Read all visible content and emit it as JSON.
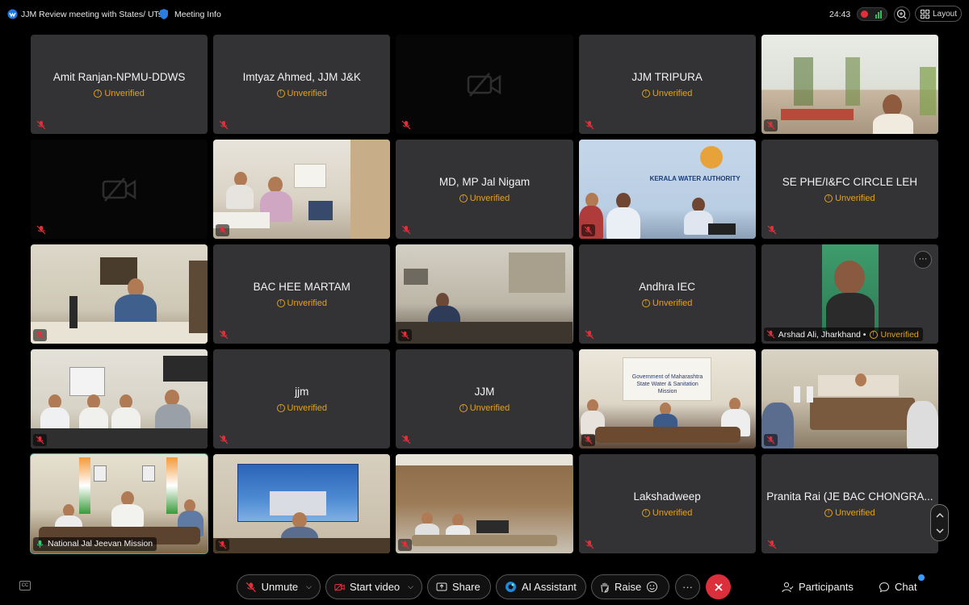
{
  "window": {
    "meeting_title": "JJM Review meeting with States/ UTs",
    "meeting_info_label": "Meeting Info",
    "timer": "24:43",
    "layout_label": "Layout"
  },
  "tiles": [
    {
      "name": "Amit Ranjan-NPMU-DDWS",
      "status": "Unverified",
      "kind": "name"
    },
    {
      "name": "Imtyaz Ahmed, JJM J&K",
      "status": "Unverified",
      "kind": "name"
    },
    {
      "name": "",
      "status": "",
      "kind": "camera-off"
    },
    {
      "name": "JJM TRIPURA",
      "status": "Unverified",
      "kind": "name"
    },
    {
      "name": "",
      "status": "",
      "kind": "video"
    },
    {
      "name": "",
      "status": "",
      "kind": "camera-off"
    },
    {
      "name": "",
      "status": "",
      "kind": "video"
    },
    {
      "name": "MD, MP Jal Nigam",
      "status": "Unverified",
      "kind": "name"
    },
    {
      "name": "",
      "status": "",
      "kind": "video",
      "sign_text": "KERALA WATER AUTHORITY"
    },
    {
      "name": "SE PHE/I&FC CIRCLE LEH",
      "status": "Unverified",
      "kind": "name"
    },
    {
      "name": "",
      "status": "",
      "kind": "video"
    },
    {
      "name": "BAC HEE MARTAM",
      "status": "Unverified",
      "kind": "name"
    },
    {
      "name": "",
      "status": "",
      "kind": "video"
    },
    {
      "name": "Andhra IEC",
      "status": "Unverified",
      "kind": "name"
    },
    {
      "name": "Arshad Ali, Jharkhand •",
      "status": "Unverified",
      "kind": "video-labeled"
    },
    {
      "name": "",
      "status": "",
      "kind": "video"
    },
    {
      "name": "jjm",
      "status": "Unverified",
      "kind": "name"
    },
    {
      "name": "JJM",
      "status": "Unverified",
      "kind": "name"
    },
    {
      "name": "",
      "status": "",
      "kind": "video",
      "sign_text": "Government of Maharashtra\nState Water & Sanitation Mission"
    },
    {
      "name": "",
      "status": "",
      "kind": "video"
    },
    {
      "name": "National Jal Jeevan Mission",
      "status": "",
      "kind": "video-active"
    },
    {
      "name": "",
      "status": "",
      "kind": "video"
    },
    {
      "name": "",
      "status": "",
      "kind": "video"
    },
    {
      "name": "Lakshadweep",
      "status": "Unverified",
      "kind": "name"
    },
    {
      "name": "Pranita Rai (JE BAC CHONGRA...",
      "status": "Unverified",
      "kind": "name"
    }
  ],
  "toolbar": {
    "unmute_label": "Unmute",
    "start_video_label": "Start video",
    "share_label": "Share",
    "ai_assistant_label": "AI Assistant",
    "raise_label": "Raise",
    "more_label": "···",
    "participants_label": "Participants",
    "chat_label": "Chat",
    "cc_label": "CC"
  },
  "colors": {
    "tile_bg": "#333335",
    "warning": "#e3a21a",
    "active_border": "#2fb8a6",
    "leave": "#dc2f3c",
    "accent": "#3a9bff"
  }
}
